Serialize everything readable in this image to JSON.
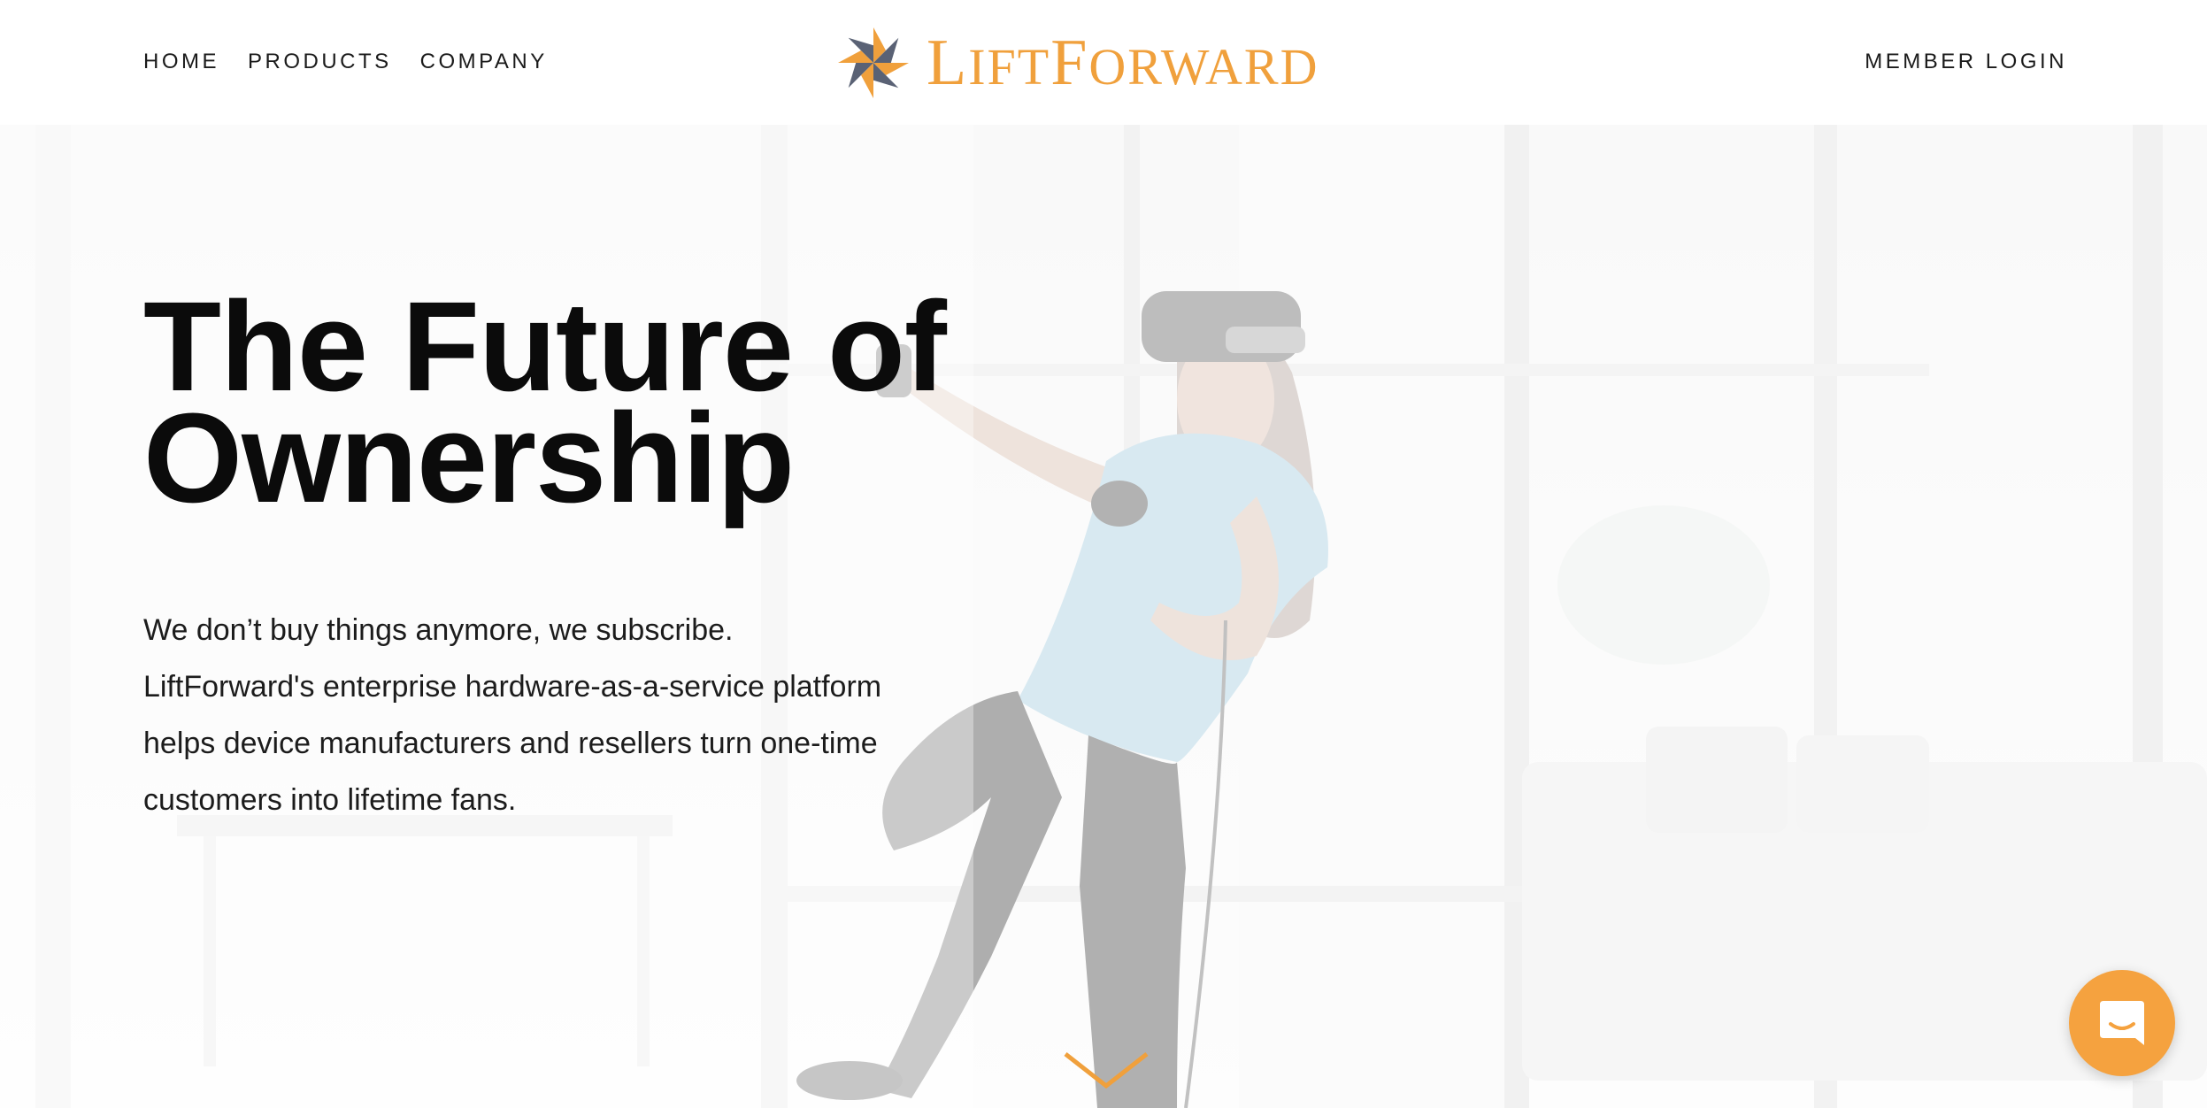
{
  "header": {
    "nav": [
      {
        "label": "HOME"
      },
      {
        "label": "PRODUCTS"
      },
      {
        "label": "COMPANY"
      }
    ],
    "logo": {
      "initial_1": "L",
      "rest_1": "IFT",
      "initial_2": "F",
      "rest_2": "ORWARD",
      "icon": "pinwheel-icon"
    },
    "member_login": "MEMBER LOGIN"
  },
  "hero": {
    "title_line_1": "The Future of",
    "title_line_2": "Ownership",
    "body_lines": [
      "We don’t buy things anymore, we subscribe.",
      "LiftForward's enterprise hardware-as-a-service platform",
      "helps device manufacturers and resellers turn one-time",
      "customers into lifetime fans."
    ],
    "scroll_icon": "chevron-down-icon"
  },
  "chat": {
    "icon": "chat-bubble-icon"
  },
  "colors": {
    "brand_orange": "#f0a03c",
    "logo_gray": "#5a6275",
    "text": "#0b0b0b",
    "chat_bg": "#f5a23f"
  }
}
